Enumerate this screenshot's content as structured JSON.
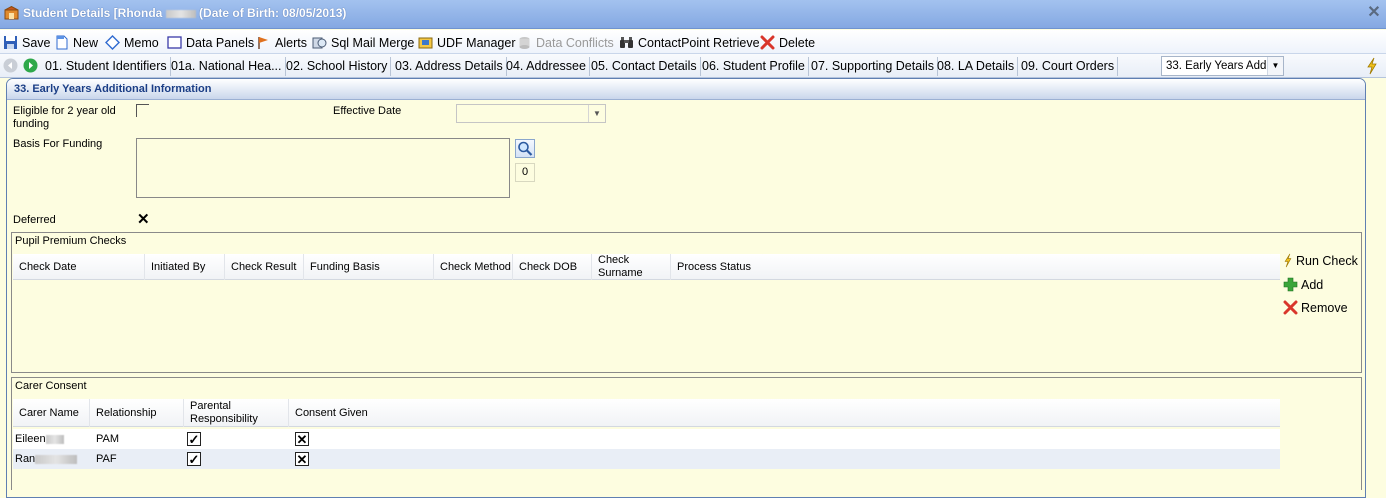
{
  "window": {
    "title": "Student Details [Rhonda",
    "title_dob": "(Date of Birth: 08/05/2013)",
    "close_icon": "close-icon"
  },
  "toolbar": {
    "save": "Save",
    "new": "New",
    "memo": "Memo",
    "data_panels": "Data Panels",
    "alerts": "Alerts",
    "sql_mail_merge": "Sql Mail Merge",
    "udf_manager": "UDF Manager",
    "data_conflicts": "Data Conflicts",
    "contactpoint_retrieve": "ContactPoint Retrieve",
    "delete": "Delete"
  },
  "tabs": [
    "01. Student Identifiers",
    "01a. National Hea...",
    "02. School History",
    "03. Address Details",
    "04. Addressee",
    "05. Contact Details",
    "06. Student Profile",
    "07. Supporting Details",
    "08. LA Details",
    "09. Court Orders"
  ],
  "tab_select": {
    "value": "33. Early Years Addi"
  },
  "panel": {
    "title": "33. Early Years Additional Information",
    "eligible_label": "Eligible for 2 year old funding",
    "effective_date_label": "Effective Date",
    "effective_date_value": "",
    "basis_label": "Basis For Funding",
    "basis_value": "",
    "basis_count": "0",
    "deferred_label": "Deferred",
    "deferred_mark": "✕"
  },
  "pupil_premium": {
    "title": "Pupil Premium Checks",
    "columns": [
      "Check Date",
      "Initiated By",
      "Check Result",
      "Funding Basis",
      "Check Method",
      "Check DOB",
      "Check Surname",
      "Process Status"
    ],
    "rows": [],
    "actions": {
      "run_check": "Run Check",
      "add": "Add",
      "remove": "Remove"
    }
  },
  "carer_consent": {
    "title": "Carer Consent",
    "columns": [
      "Carer Name",
      "Relationship",
      "Parental Responsibility",
      "Consent Given"
    ],
    "rows": [
      {
        "name": "Eileen",
        "relationship": "PAM",
        "parental_responsibility": "✓",
        "consent_given": "✕"
      },
      {
        "name": "Ran",
        "relationship": "PAF",
        "parental_responsibility": "✓",
        "consent_given": "✕"
      }
    ]
  },
  "colors": {
    "background": "#fdfde0",
    "title_bar": "#93b5e8",
    "panel_title": "#1b3e86",
    "delete_red": "#d9362b",
    "add_green": "#3aa53a"
  }
}
